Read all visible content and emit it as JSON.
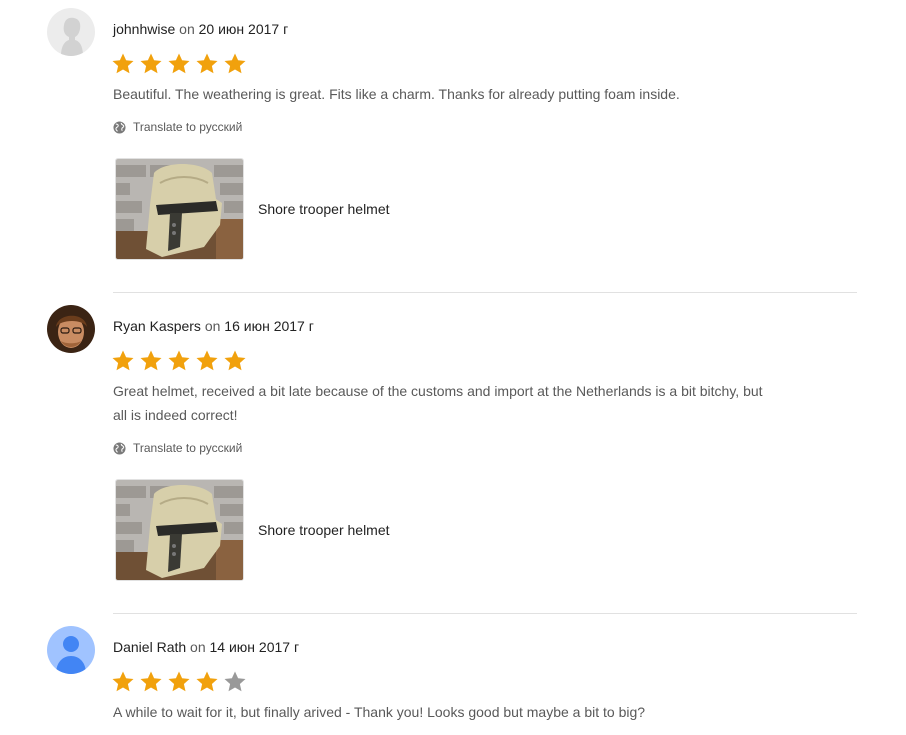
{
  "reviews": [
    {
      "user": "johnhwise",
      "on": "on",
      "date": "20 июн 2017 г",
      "rating": 5,
      "rating_max": 5,
      "avatar": "default-person-icon",
      "text": "Beautiful. The weathering is great. Fits like a charm. Thanks for already putting foam inside.",
      "translate_label": "Translate to русский",
      "item_title": "Shore trooper helmet"
    },
    {
      "user": "Ryan Kaspers",
      "on": "on",
      "date": "16 июн 2017 г",
      "rating": 5,
      "rating_max": 5,
      "avatar": "photo-avatar",
      "text": "Great helmet, received a bit late because of the customs and import at the Netherlands is a bit bitchy, but all is indeed correct!",
      "translate_label": "Translate to русский",
      "item_title": "Shore trooper helmet"
    },
    {
      "user": "Daniel Rath",
      "on": "on",
      "date": "14 июн 2017 г",
      "rating": 4,
      "rating_max": 5,
      "avatar": "default-blue-person-icon",
      "text": "A while to wait for it, but finally arived - Thank you! Looks good but maybe a bit to big?"
    }
  ],
  "colors": {
    "star_filled": "#f1a10d",
    "star_empty": "#999999",
    "divider": "#e1e1e1",
    "text_muted": "#595959"
  }
}
